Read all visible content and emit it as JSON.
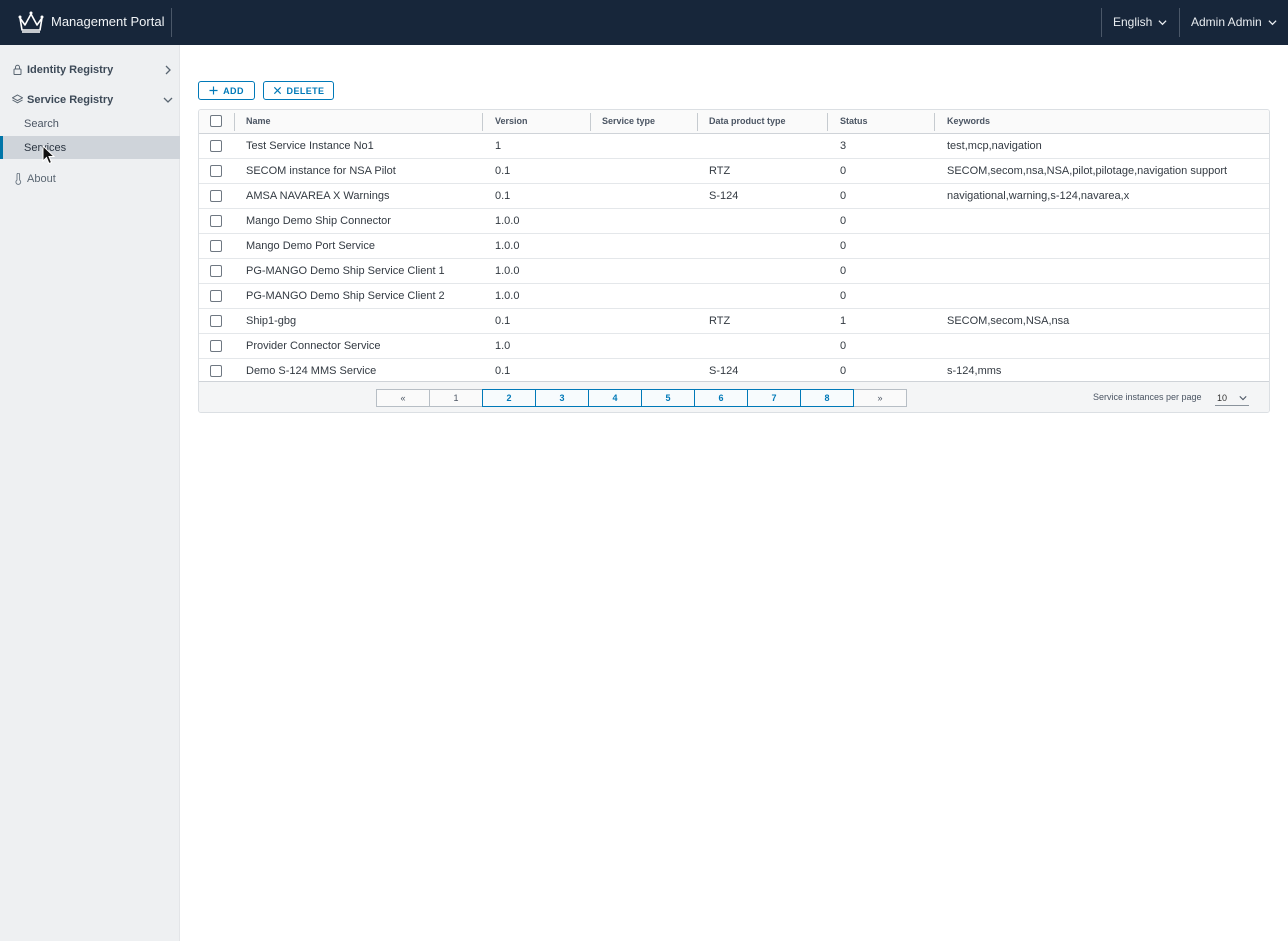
{
  "header": {
    "title": "Management Portal",
    "language": "English",
    "user": "Admin Admin",
    "background": "#17263a"
  },
  "sidebar": {
    "groups": [
      {
        "label": "Identity Registry",
        "icon": "lock-icon",
        "expanded": false
      },
      {
        "label": "Service Registry",
        "icon": "layers-icon",
        "expanded": true,
        "items": [
          {
            "label": "Search",
            "active": false
          },
          {
            "label": "Services",
            "active": true
          }
        ]
      }
    ],
    "about": {
      "label": "About",
      "icon": "thermometer-icon"
    }
  },
  "toolbar": {
    "add_label": "ADD",
    "delete_label": "DELETE",
    "accent": "#0079b8"
  },
  "table": {
    "columns": [
      "Name",
      "Version",
      "Service type",
      "Data product type",
      "Status",
      "Keywords"
    ],
    "rows": [
      {
        "name": "Test Service Instance No1",
        "version": "1",
        "service_type": "",
        "data_product_type": "",
        "status": "3",
        "keywords": "test,mcp,navigation"
      },
      {
        "name": "SECOM instance for NSA Pilot",
        "version": "0.1",
        "service_type": "",
        "data_product_type": "RTZ",
        "status": "0",
        "keywords": "SECOM,secom,nsa,NSA,pilot,pilotage,navigation support"
      },
      {
        "name": "AMSA NAVAREA X Warnings",
        "version": "0.1",
        "service_type": "",
        "data_product_type": "S-124",
        "status": "0",
        "keywords": "navigational,warning,s-124,navarea,x"
      },
      {
        "name": "Mango Demo Ship Connector",
        "version": "1.0.0",
        "service_type": "",
        "data_product_type": "",
        "status": "0",
        "keywords": ""
      },
      {
        "name": "Mango Demo Port Service",
        "version": "1.0.0",
        "service_type": "",
        "data_product_type": "",
        "status": "0",
        "keywords": ""
      },
      {
        "name": "PG-MANGO Demo Ship Service Client 1",
        "version": "1.0.0",
        "service_type": "",
        "data_product_type": "",
        "status": "0",
        "keywords": ""
      },
      {
        "name": "PG-MANGO Demo Ship Service Client 2",
        "version": "1.0.0",
        "service_type": "",
        "data_product_type": "",
        "status": "0",
        "keywords": ""
      },
      {
        "name": "Ship1-gbg",
        "version": "0.1",
        "service_type": "",
        "data_product_type": "RTZ",
        "status": "1",
        "keywords": "SECOM,secom,NSA,nsa"
      },
      {
        "name": "Provider Connector Service",
        "version": "1.0",
        "service_type": "",
        "data_product_type": "",
        "status": "0",
        "keywords": ""
      },
      {
        "name": "Demo S-124 MMS Service",
        "version": "0.1",
        "service_type": "",
        "data_product_type": "S-124",
        "status": "0",
        "keywords": "s-124,mms"
      }
    ]
  },
  "pagination": {
    "prev": "«",
    "next": "»",
    "pages": [
      "1",
      "2",
      "3",
      "4",
      "5",
      "6",
      "7",
      "8"
    ],
    "current_page": "1",
    "per_page_label": "Service instances per page",
    "per_page_value": "10"
  }
}
